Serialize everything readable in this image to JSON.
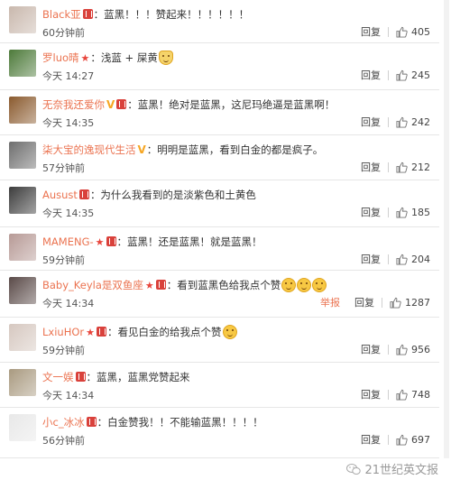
{
  "labels": {
    "reply": "回复",
    "report": "举报"
  },
  "comments": [
    {
      "user": "Black亚",
      "marks": [
        "badge"
      ],
      "text": "：蓝黑！！！赞起来！！！！！！",
      "emoji_count": 0,
      "time": "60分钟前",
      "likes": "405",
      "report": false,
      "avatar_icon": "avatar-man-photo",
      "avatar_color": "#c9b8ad"
    },
    {
      "user": "罗luo晴",
      "marks": [
        "star"
      ],
      "text": "：浅蓝 + 屎黄",
      "emoji_count": 1,
      "emoji_kind": "cat",
      "time": "今天 14:27",
      "likes": "245",
      "report": false,
      "avatar_icon": "avatar-green-photo",
      "avatar_color": "#4d7a3a"
    },
    {
      "user": "无奈我还爱你",
      "marks": [
        "v",
        "badge"
      ],
      "text": "：蓝黑！绝对是蓝黑，这尼玛绝逼是蓝黑啊！",
      "emoji_count": 0,
      "time": "今天 14:35",
      "likes": "242",
      "report": false,
      "avatar_icon": "avatar-brown-photo",
      "avatar_color": "#8a5a2e"
    },
    {
      "user": "柒大宝的逸现代生活",
      "marks": [
        "v"
      ],
      "text": "：明明是蓝黑，看到白金的都是疯子。",
      "emoji_count": 0,
      "time": "57分钟前",
      "likes": "212",
      "report": false,
      "avatar_icon": "avatar-street-photo",
      "avatar_color": "#6e6e6e"
    },
    {
      "user": "Ausust",
      "marks": [
        "badge"
      ],
      "text": "：为什么我看到的是淡紫色和土黄色",
      "emoji_count": 0,
      "time": "今天 14:35",
      "likes": "185",
      "report": false,
      "avatar_icon": "avatar-dark-photo",
      "avatar_color": "#3c3c3c"
    },
    {
      "user": "MAMENG-",
      "marks": [
        "star",
        "badge"
      ],
      "text": "：蓝黑！还是蓝黑！就是蓝黑！",
      "emoji_count": 0,
      "time": "59分钟前",
      "likes": "204",
      "report": false,
      "avatar_icon": "avatar-girl-photo",
      "avatar_color": "#b79a96"
    },
    {
      "user": "Baby_Keyla是双鱼座",
      "marks": [
        "star",
        "badge"
      ],
      "text": "：看到蓝黑色给我点个赞",
      "emoji_count": 3,
      "emoji_kind": "cry",
      "time": "今天 14:34",
      "likes": "1287",
      "report": true,
      "avatar_icon": "avatar-woman-photo",
      "avatar_color": "#5a4a48"
    },
    {
      "user": "LxiuHOr",
      "marks": [
        "star",
        "badge"
      ],
      "text": "：看见白金的给我点个赞",
      "emoji_count": 1,
      "emoji_kind": "shock",
      "time": "59分钟前",
      "likes": "956",
      "report": false,
      "avatar_icon": "avatar-selfie-photo",
      "avatar_color": "#d6c8c0"
    },
    {
      "user": "文一娱",
      "marks": [
        "badge"
      ],
      "text": "：蓝黑，蓝黑党赞起来",
      "emoji_count": 0,
      "time": "今天 14:34",
      "likes": "748",
      "report": false,
      "avatar_icon": "avatar-cat-photo",
      "avatar_color": "#a99a80"
    },
    {
      "user": "小c_冰冰",
      "marks": [
        "badge"
      ],
      "text": "：白金赞我！！不能输蓝黑！！！！",
      "emoji_count": 0,
      "time": "56分钟前",
      "likes": "697",
      "report": false,
      "avatar_icon": "avatar-panda-photo",
      "avatar_color": "#e8e8e8"
    }
  ],
  "watermark": "21世纪英文报",
  "watermark_icon": "wechat-icon",
  "thumb_icon": "thumbs-up-icon"
}
